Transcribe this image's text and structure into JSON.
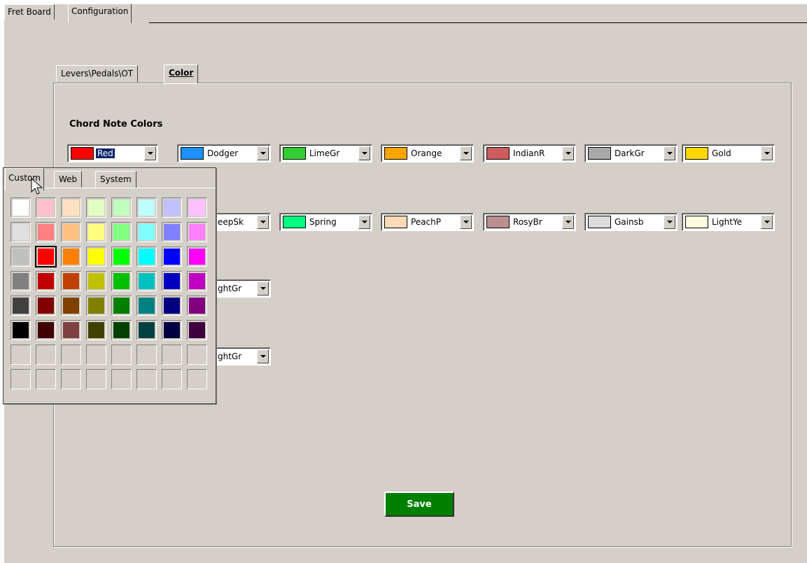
{
  "top_tabs": {
    "fret_board": "Fret Board",
    "configuration": "Configuration"
  },
  "sub_tabs": {
    "levers": "Levers\\Pedals\\OT",
    "color": "Color"
  },
  "section": {
    "title": "Chord Note Colors"
  },
  "row1": [
    {
      "label": "Red",
      "color": "#ff0000"
    },
    {
      "label": "Dodger",
      "color": "#1e90ff"
    },
    {
      "label": "LimeGr",
      "color": "#32cd32"
    },
    {
      "label": "Orange",
      "color": "#ffa500"
    },
    {
      "label": "IndianR",
      "color": "#cd5c5c"
    },
    {
      "label": "DarkGr",
      "color": "#a9a9a9"
    },
    {
      "label": "Gold",
      "color": "#ffd700"
    }
  ],
  "row2": [
    {
      "label": "eepSk"
    },
    {
      "label": "Spring",
      "color": "#00ff7f"
    },
    {
      "label": "PeachP",
      "color": "#ffdab9"
    },
    {
      "label": "RosyBr",
      "color": "#bc8f8f"
    },
    {
      "label": "Gainsb",
      "color": "#dcdcdc"
    },
    {
      "label": "LightYe",
      "color": "#ffffe0"
    }
  ],
  "row3": {
    "label": "ghtGr"
  },
  "row4": {
    "label": "ghtGr"
  },
  "save_label": "Save",
  "popup": {
    "tabs": [
      "Custom",
      "Web",
      "System"
    ],
    "palette": [
      [
        "#ffffff",
        "#ffc0cb",
        "#ffe0c0",
        "#e0ffc0",
        "#c0ffc0",
        "#c0ffff",
        "#c0c0ff",
        "#ffc0ff"
      ],
      [
        "#e0e0e0",
        "#ff8080",
        "#ffc080",
        "#ffff80",
        "#80ff80",
        "#80ffff",
        "#8080ff",
        "#ff80ff"
      ],
      [
        "#c0c0c0",
        "#ff0000",
        "#ff8000",
        "#ffff00",
        "#00ff00",
        "#00ffff",
        "#0000ff",
        "#ff00ff"
      ],
      [
        "#808080",
        "#c00000",
        "#c04000",
        "#c0c000",
        "#00c000",
        "#00c0c0",
        "#0000c0",
        "#c000c0"
      ],
      [
        "#404040",
        "#800000",
        "#804000",
        "#808000",
        "#008000",
        "#008080",
        "#000080",
        "#800080"
      ],
      [
        "#000000",
        "#400000",
        "#804040",
        "#404000",
        "#004000",
        "#004040",
        "#000040",
        "#400040"
      ]
    ],
    "selected": "#ff0000"
  }
}
